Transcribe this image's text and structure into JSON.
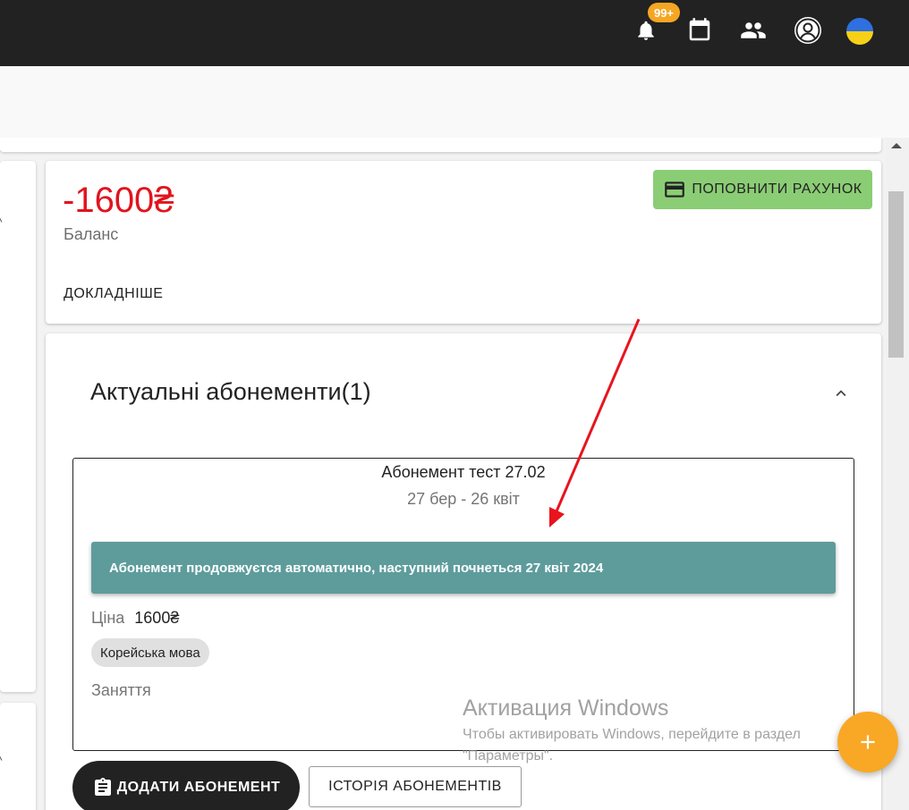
{
  "header": {
    "notification_count": "99+",
    "icons": [
      "bell-icon",
      "calendar-icon",
      "people-icon",
      "account-icon",
      "ukraine-flag"
    ],
    "flag_colors": {
      "top": "#2f6fe0",
      "bottom": "#f7d117"
    }
  },
  "balance": {
    "amount": "-1600₴",
    "label": "Баланс",
    "topup_label": "ПОПОВНИТИ РАХУНОК",
    "details_label": "ДОКЛАДНІШЕ",
    "amount_color": "#e0141e",
    "topup_color": "#8bcd75"
  },
  "subscriptions": {
    "title": "Актуальні абонементи(1)",
    "items": [
      {
        "name": "Абонемент тест 27.02",
        "dates": "27 бер - 26 квіт",
        "auto_renew_text": "Абонемент продовжуєтся автоматично, наступний почнеться 27 квіт 2024",
        "price_label": "Ціна",
        "price_value": "1600₴",
        "tag": "Корейська мова",
        "lessons_label": "Заняття"
      }
    ],
    "add_button": "ДОДАТИ АБОНЕМЕНТ",
    "history_button": "ІСТОРІЯ АБОНЕМЕНТІВ",
    "banner_color": "#5e9c9c"
  },
  "watermark": {
    "title": "Активация Windows",
    "line1": "Чтобы активировать Windows, перейдите в раздел",
    "line2": "\"Параметры\"."
  },
  "fab": {
    "icon": "plus-icon",
    "color": "#f9a825"
  }
}
